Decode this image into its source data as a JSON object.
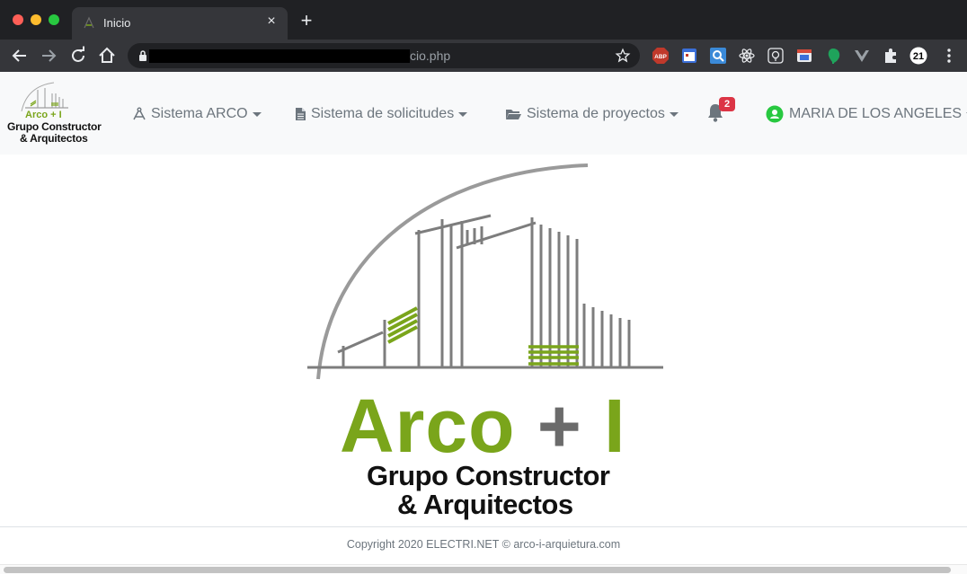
{
  "browser": {
    "tab_title": "Inicio",
    "url_visible": "cio.php"
  },
  "app": {
    "brand": {
      "arco": "Arco + I",
      "line1": "Grupo Constructor",
      "line2": "& Arquitectos"
    },
    "nav": [
      {
        "label": "Sistema ARCO",
        "icon": "compass-drafting-icon"
      },
      {
        "label": "Sistema de solicitudes",
        "icon": "document-icon"
      },
      {
        "label": "Sistema de proyectos",
        "icon": "folder-open-icon"
      }
    ],
    "notifications": {
      "count": "2",
      "icon": "bell-icon"
    },
    "user": {
      "name": "MARIA DE LOS ANGELES",
      "icon": "user-status-icon"
    }
  },
  "hero": {
    "title_main": "Arco",
    "title_plus": "+",
    "title_i": "I",
    "line1": "Grupo Constructor",
    "line2": "& Arquitectos"
  },
  "footer": {
    "copyright": "Copyright 2020 ELECTRI.NET © arco-i-arquietura.com"
  },
  "colors": {
    "brand_green": "#7aa51b",
    "badge_red": "#dc3545",
    "nav_text": "#6c757d",
    "navbar_bg": "#f8f9fa"
  }
}
